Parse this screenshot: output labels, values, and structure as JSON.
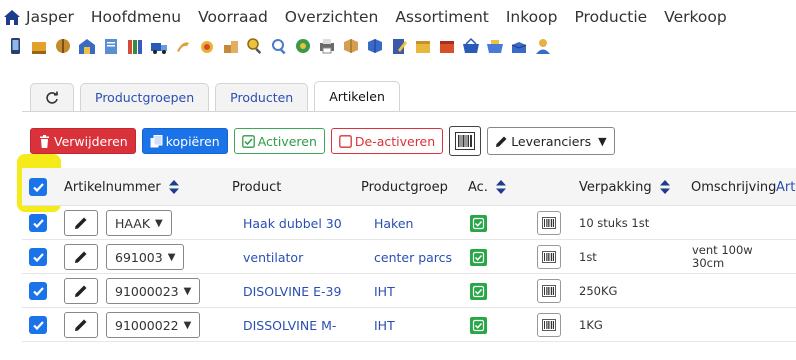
{
  "menu": {
    "items": [
      "Jasper",
      "Hoofdmenu",
      "Voorraad",
      "Overzichten",
      "Assortiment",
      "Inkoop",
      "Productie",
      "Verkoop"
    ]
  },
  "toolbar_icons": [
    "mobile-icon",
    "pallet-icon",
    "tools-icon",
    "warehouse-icon",
    "document-icon",
    "books-icon",
    "truck-icon",
    "paint-icon",
    "order-icon",
    "boxes-icon",
    "search-icon",
    "search-list-icon",
    "recycle-icon",
    "printer-icon",
    "package-icon",
    "package-blue-icon",
    "document-edit-icon",
    "box-yellow-icon",
    "box-red-icon",
    "basket-icon",
    "basket-blue-icon",
    "box-open-icon",
    "user-icon"
  ],
  "tabs": {
    "refresh_icon": "refresh-icon",
    "items": [
      "Productgroepen",
      "Producten",
      "Artikelen"
    ],
    "active": "Artikelen"
  },
  "actions": {
    "delete": "Verwijderen",
    "copy": "kopiëren",
    "activate": "Activeren",
    "deactivate": "De-activeren",
    "suppliers": "Leveranciers"
  },
  "table": {
    "headers": {
      "article_number": "Artikelnummer",
      "product": "Product",
      "product_group": "Productgroep",
      "active": "Ac.",
      "packaging": "Verpakking",
      "description": "Omschrijving",
      "overflow": "Art"
    },
    "rows": [
      {
        "article": "HAAK",
        "product": "Haak dubbel 30",
        "group": "Haken",
        "packaging": "10 stuks 1st",
        "description": ""
      },
      {
        "article": "691003",
        "product": "ventilator",
        "group": "center parcs",
        "packaging": "1st",
        "description": "vent 100w 30cm"
      },
      {
        "article": "91000023",
        "product": "DISOLVINE E-39",
        "group": "IHT",
        "packaging": "250KG",
        "description": ""
      },
      {
        "article": "91000022",
        "product": "DISSOLVINE M-",
        "group": "IHT",
        "packaging": "1KG",
        "description": ""
      }
    ]
  },
  "colors": {
    "accent_blue": "#1a73e8",
    "danger_red": "#d9323a",
    "success_green": "#27a745",
    "highlight_yellow": "#f5ea1a",
    "link_blue": "#2a4fb1"
  }
}
